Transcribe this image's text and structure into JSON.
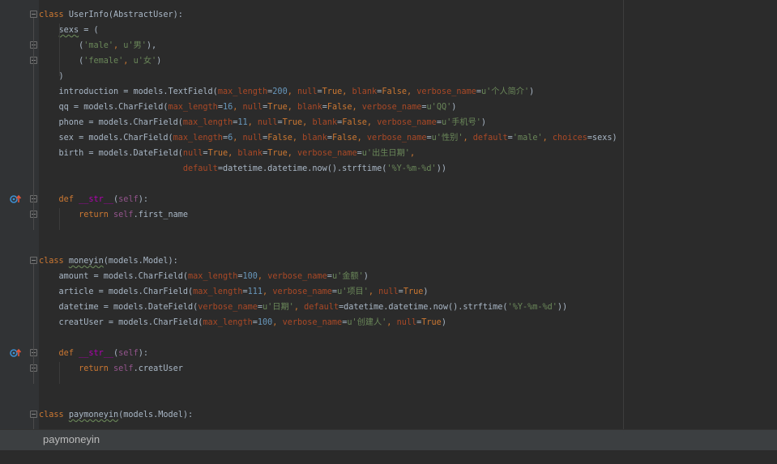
{
  "breadcrumb": {
    "current": "paymoneyin"
  },
  "gutter_icons": {
    "override": "override-method-icon",
    "fold": "fold-marker-icon"
  },
  "colors": {
    "background": "#2b2b2b",
    "gutter": "#313335",
    "default_text": "#a9b7c6",
    "keyword": "#cc7832",
    "function_name": "#ffc66d",
    "number": "#6897bb",
    "string": "#6a8759",
    "named_argument": "#aa4926",
    "self": "#94558d",
    "magic_method": "#b200b2",
    "breadcrumb_bar": "#3c3f41"
  },
  "code_lines": [
    [
      {
        "t": "class ",
        "c": "kw"
      },
      {
        "t": "UserInfo(AbstractUser):",
        "c": ""
      }
    ],
    [
      {
        "t": "    ",
        "c": ""
      },
      {
        "t": "sexs",
        "c": "warn"
      },
      {
        "t": " = (",
        "c": ""
      }
    ],
    [
      {
        "t": "        (",
        "c": ""
      },
      {
        "t": "'male'",
        "c": "str"
      },
      {
        "t": ", ",
        "c": "kw"
      },
      {
        "t": "u'男'",
        "c": "str"
      },
      {
        "t": "),",
        "c": ""
      }
    ],
    [
      {
        "t": "        (",
        "c": ""
      },
      {
        "t": "'female'",
        "c": "str"
      },
      {
        "t": ", ",
        "c": "kw"
      },
      {
        "t": "u'女'",
        "c": "str"
      },
      {
        "t": ")",
        "c": ""
      }
    ],
    [
      {
        "t": "    )",
        "c": ""
      }
    ],
    [
      {
        "t": "    introduction = models.TextField(",
        "c": ""
      },
      {
        "t": "max_length",
        "c": "param"
      },
      {
        "t": "=",
        "c": ""
      },
      {
        "t": "200",
        "c": "num"
      },
      {
        "t": ", ",
        "c": "kw"
      },
      {
        "t": "null",
        "c": "param"
      },
      {
        "t": "=",
        "c": ""
      },
      {
        "t": "True",
        "c": "kw"
      },
      {
        "t": ", ",
        "c": "kw"
      },
      {
        "t": "blank",
        "c": "param"
      },
      {
        "t": "=",
        "c": ""
      },
      {
        "t": "False",
        "c": "kw"
      },
      {
        "t": ", ",
        "c": "kw"
      },
      {
        "t": "verbose_name",
        "c": "param"
      },
      {
        "t": "=",
        "c": ""
      },
      {
        "t": "u'个人简介'",
        "c": "str"
      },
      {
        "t": ")",
        "c": ""
      }
    ],
    [
      {
        "t": "    qq = models.CharField(",
        "c": ""
      },
      {
        "t": "max_length",
        "c": "param"
      },
      {
        "t": "=",
        "c": ""
      },
      {
        "t": "16",
        "c": "num"
      },
      {
        "t": ", ",
        "c": "kw"
      },
      {
        "t": "null",
        "c": "param"
      },
      {
        "t": "=",
        "c": ""
      },
      {
        "t": "True",
        "c": "kw"
      },
      {
        "t": ", ",
        "c": "kw"
      },
      {
        "t": "blank",
        "c": "param"
      },
      {
        "t": "=",
        "c": ""
      },
      {
        "t": "False",
        "c": "kw"
      },
      {
        "t": ", ",
        "c": "kw"
      },
      {
        "t": "verbose_name",
        "c": "param"
      },
      {
        "t": "=",
        "c": ""
      },
      {
        "t": "u'QQ'",
        "c": "str"
      },
      {
        "t": ")",
        "c": ""
      }
    ],
    [
      {
        "t": "    phone = models.CharField(",
        "c": ""
      },
      {
        "t": "max_length",
        "c": "param"
      },
      {
        "t": "=",
        "c": ""
      },
      {
        "t": "11",
        "c": "num"
      },
      {
        "t": ", ",
        "c": "kw"
      },
      {
        "t": "null",
        "c": "param"
      },
      {
        "t": "=",
        "c": ""
      },
      {
        "t": "True",
        "c": "kw"
      },
      {
        "t": ", ",
        "c": "kw"
      },
      {
        "t": "blank",
        "c": "param"
      },
      {
        "t": "=",
        "c": ""
      },
      {
        "t": "False",
        "c": "kw"
      },
      {
        "t": ", ",
        "c": "kw"
      },
      {
        "t": "verbose_name",
        "c": "param"
      },
      {
        "t": "=",
        "c": ""
      },
      {
        "t": "u'手机号'",
        "c": "str"
      },
      {
        "t": ")",
        "c": ""
      }
    ],
    [
      {
        "t": "    sex = models.CharField(",
        "c": ""
      },
      {
        "t": "max_length",
        "c": "param"
      },
      {
        "t": "=",
        "c": ""
      },
      {
        "t": "6",
        "c": "num"
      },
      {
        "t": ", ",
        "c": "kw"
      },
      {
        "t": "null",
        "c": "param"
      },
      {
        "t": "=",
        "c": ""
      },
      {
        "t": "False",
        "c": "kw"
      },
      {
        "t": ", ",
        "c": "kw"
      },
      {
        "t": "blank",
        "c": "param"
      },
      {
        "t": "=",
        "c": ""
      },
      {
        "t": "False",
        "c": "kw"
      },
      {
        "t": ", ",
        "c": "kw"
      },
      {
        "t": "verbose_name",
        "c": "param"
      },
      {
        "t": "=",
        "c": ""
      },
      {
        "t": "u'性别'",
        "c": "str"
      },
      {
        "t": ", ",
        "c": "kw"
      },
      {
        "t": "default",
        "c": "param"
      },
      {
        "t": "=",
        "c": ""
      },
      {
        "t": "'male'",
        "c": "str"
      },
      {
        "t": ", ",
        "c": "kw"
      },
      {
        "t": "choices",
        "c": "param"
      },
      {
        "t": "=sexs)",
        "c": ""
      }
    ],
    [
      {
        "t": "    birth = models.DateField(",
        "c": ""
      },
      {
        "t": "null",
        "c": "param"
      },
      {
        "t": "=",
        "c": ""
      },
      {
        "t": "True",
        "c": "kw"
      },
      {
        "t": ", ",
        "c": "kw"
      },
      {
        "t": "blank",
        "c": "param"
      },
      {
        "t": "=",
        "c": ""
      },
      {
        "t": "True",
        "c": "kw"
      },
      {
        "t": ", ",
        "c": "kw"
      },
      {
        "t": "verbose_name",
        "c": "param"
      },
      {
        "t": "=",
        "c": ""
      },
      {
        "t": "u'出生日期'",
        "c": "str"
      },
      {
        "t": ",",
        "c": "kw"
      }
    ],
    [
      {
        "t": "                             ",
        "c": ""
      },
      {
        "t": "default",
        "c": "param"
      },
      {
        "t": "=datetime.datetime.now().strftime(",
        "c": ""
      },
      {
        "t": "'%Y-%m-%d'",
        "c": "str"
      },
      {
        "t": "))",
        "c": ""
      }
    ],
    [],
    [
      {
        "t": "    ",
        "c": ""
      },
      {
        "t": "def ",
        "c": "kw"
      },
      {
        "t": "__str__",
        "c": "magic"
      },
      {
        "t": "(",
        "c": ""
      },
      {
        "t": "self",
        "c": "self"
      },
      {
        "t": "):",
        "c": ""
      }
    ],
    [
      {
        "t": "        ",
        "c": ""
      },
      {
        "t": "return ",
        "c": "kw"
      },
      {
        "t": "self",
        "c": "self"
      },
      {
        "t": ".first_name",
        "c": ""
      }
    ],
    [],
    [],
    [
      {
        "t": "class ",
        "c": "kw"
      },
      {
        "t": "moneyin",
        "c": "warn"
      },
      {
        "t": "(models.Model):",
        "c": ""
      }
    ],
    [
      {
        "t": "    amount = models.CharField(",
        "c": ""
      },
      {
        "t": "max_length",
        "c": "param"
      },
      {
        "t": "=",
        "c": ""
      },
      {
        "t": "100",
        "c": "num"
      },
      {
        "t": ", ",
        "c": "kw"
      },
      {
        "t": "verbose_name",
        "c": "param"
      },
      {
        "t": "=",
        "c": ""
      },
      {
        "t": "u'金额'",
        "c": "str"
      },
      {
        "t": ")",
        "c": ""
      }
    ],
    [
      {
        "t": "    article = models.CharField(",
        "c": ""
      },
      {
        "t": "max_length",
        "c": "param"
      },
      {
        "t": "=",
        "c": ""
      },
      {
        "t": "111",
        "c": "num"
      },
      {
        "t": ", ",
        "c": "kw"
      },
      {
        "t": "verbose_name",
        "c": "param"
      },
      {
        "t": "=",
        "c": ""
      },
      {
        "t": "u'项目'",
        "c": "str"
      },
      {
        "t": ", ",
        "c": "kw"
      },
      {
        "t": "null",
        "c": "param"
      },
      {
        "t": "=",
        "c": ""
      },
      {
        "t": "True",
        "c": "kw"
      },
      {
        "t": ")",
        "c": ""
      }
    ],
    [
      {
        "t": "    datetime = models.DateField(",
        "c": ""
      },
      {
        "t": "verbose_name",
        "c": "param"
      },
      {
        "t": "=",
        "c": ""
      },
      {
        "t": "u'日期'",
        "c": "str"
      },
      {
        "t": ", ",
        "c": "kw"
      },
      {
        "t": "default",
        "c": "param"
      },
      {
        "t": "=datetime.datetime.now().strftime(",
        "c": ""
      },
      {
        "t": "'%Y-%m-%d'",
        "c": "str"
      },
      {
        "t": "))",
        "c": ""
      }
    ],
    [
      {
        "t": "    creatUser = models.CharField(",
        "c": ""
      },
      {
        "t": "max_length",
        "c": "param"
      },
      {
        "t": "=",
        "c": ""
      },
      {
        "t": "100",
        "c": "num"
      },
      {
        "t": ", ",
        "c": "kw"
      },
      {
        "t": "verbose_name",
        "c": "param"
      },
      {
        "t": "=",
        "c": ""
      },
      {
        "t": "u'创建人'",
        "c": "str"
      },
      {
        "t": ", ",
        "c": "kw"
      },
      {
        "t": "null",
        "c": "param"
      },
      {
        "t": "=",
        "c": ""
      },
      {
        "t": "True",
        "c": "kw"
      },
      {
        "t": ")",
        "c": ""
      }
    ],
    [],
    [
      {
        "t": "    ",
        "c": ""
      },
      {
        "t": "def ",
        "c": "kw"
      },
      {
        "t": "__str__",
        "c": "magic"
      },
      {
        "t": "(",
        "c": ""
      },
      {
        "t": "self",
        "c": "self"
      },
      {
        "t": "):",
        "c": ""
      }
    ],
    [
      {
        "t": "        ",
        "c": ""
      },
      {
        "t": "return ",
        "c": "kw"
      },
      {
        "t": "self",
        "c": "self"
      },
      {
        "t": ".creatUser",
        "c": ""
      }
    ],
    [],
    [],
    [
      {
        "t": "class ",
        "c": "kw"
      },
      {
        "t": "paymoneyin",
        "c": "warn"
      },
      {
        "t": "(models.Model):",
        "c": ""
      }
    ]
  ]
}
